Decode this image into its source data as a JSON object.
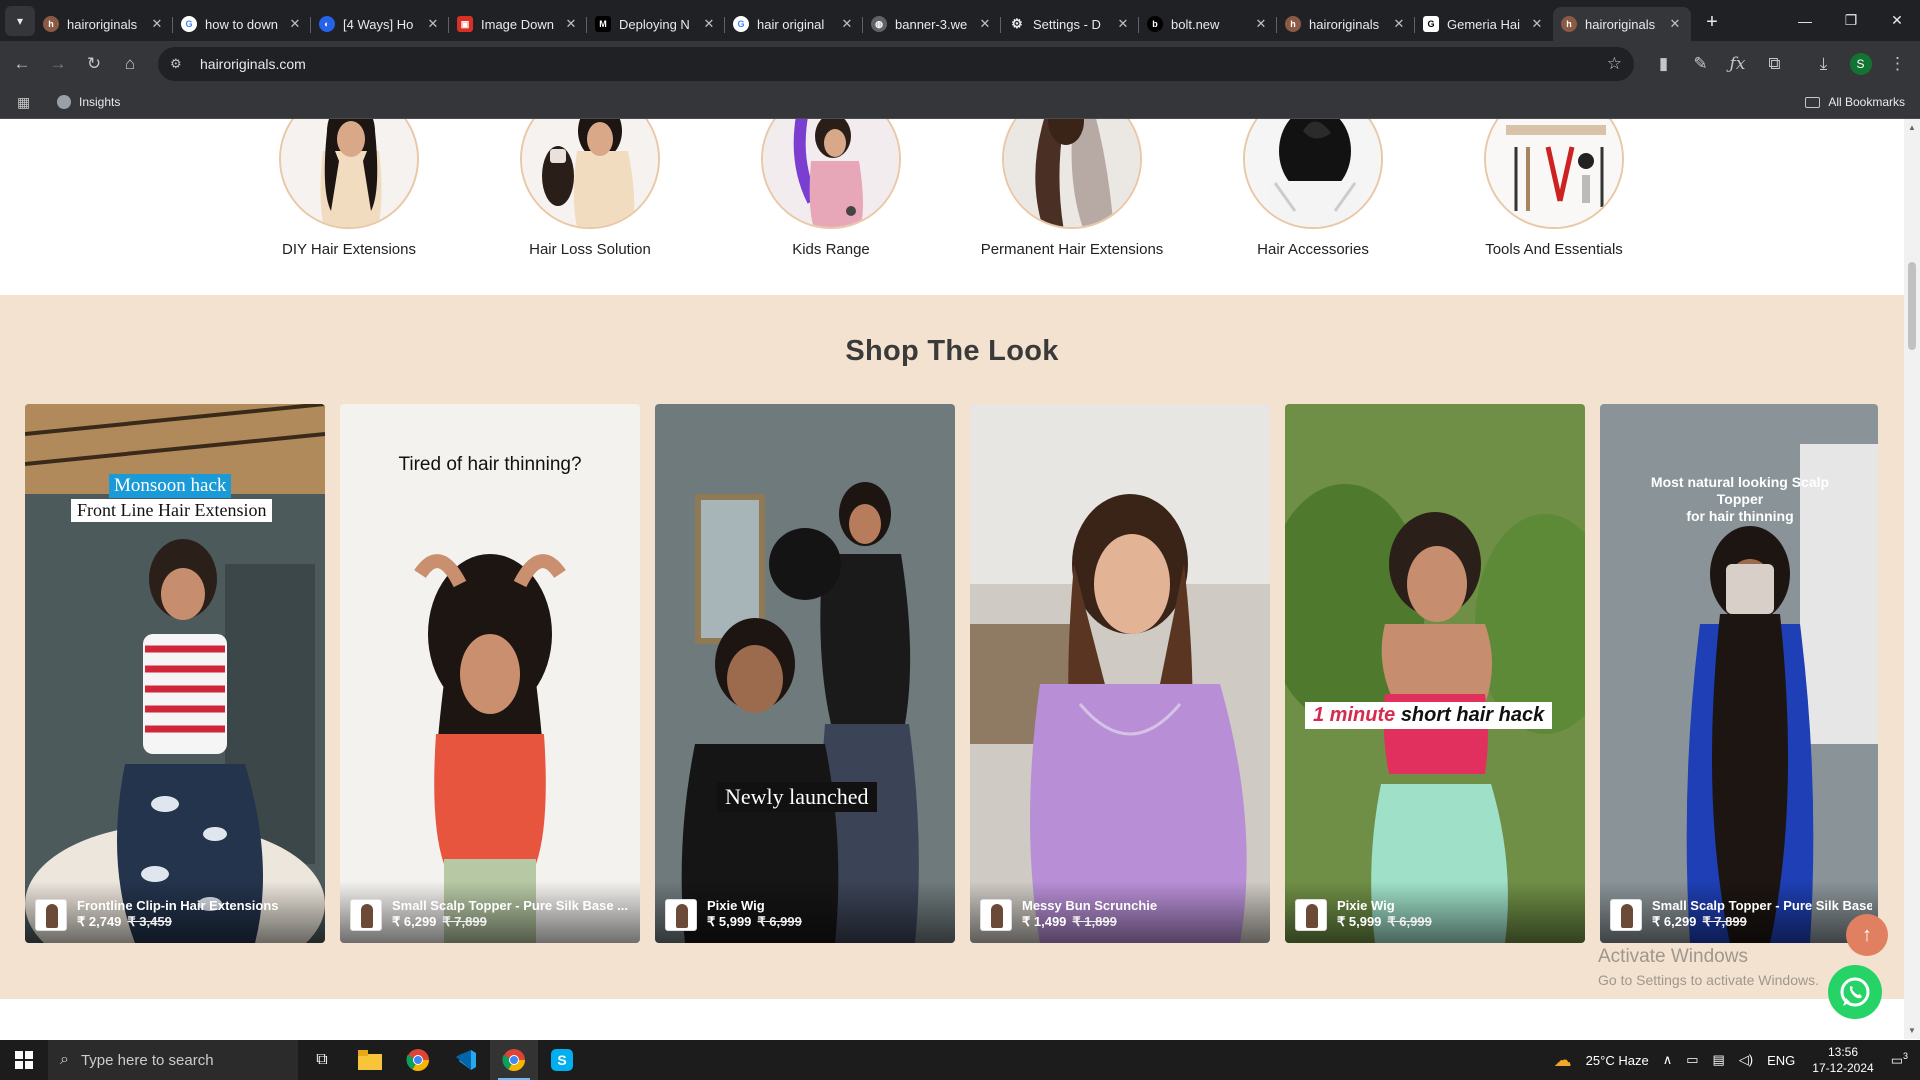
{
  "browser": {
    "tabs": [
      {
        "title": "hairoriginals",
        "active": false,
        "favicon": "hairoriginals-icon"
      },
      {
        "title": "how to down",
        "active": false,
        "favicon": "google-icon"
      },
      {
        "title": "[4 Ways] Ho",
        "active": false,
        "favicon": "edge-blue-icon"
      },
      {
        "title": "Image Down",
        "active": false,
        "favicon": "image-download-icon"
      },
      {
        "title": "Deploying N",
        "active": false,
        "favicon": "medium-icon"
      },
      {
        "title": "hair original",
        "active": false,
        "favicon": "google-icon"
      },
      {
        "title": "banner-3.we",
        "active": false,
        "favicon": "globe-icon"
      },
      {
        "title": "Settings - D",
        "active": false,
        "favicon": "gear-icon"
      },
      {
        "title": "bolt.new",
        "active": false,
        "favicon": "bolt-icon"
      },
      {
        "title": "hairoriginals",
        "active": false,
        "favicon": "hairoriginals-icon"
      },
      {
        "title": "Gemeria Hai",
        "active": false,
        "favicon": "gemeria-icon"
      },
      {
        "title": "hairoriginals",
        "active": true,
        "favicon": "hairoriginals-icon"
      }
    ],
    "url": "hairoriginals.com",
    "bookmarks": [
      {
        "label": "Insights"
      }
    ],
    "all_bookmarks_label": "All Bookmarks",
    "profile_initial": "S"
  },
  "categories": [
    {
      "label": "DIY Hair Extensions"
    },
    {
      "label": "Hair Loss Solution"
    },
    {
      "label": "Kids Range"
    },
    {
      "label": "Permanent Hair Extensions"
    },
    {
      "label": "Hair Accessories"
    },
    {
      "label": "Tools And Essentials"
    }
  ],
  "shop": {
    "title": "Shop The Look",
    "cards": [
      {
        "overlay_lines": [
          "Monsoon hack",
          "Front Line Hair Extension"
        ],
        "product": "Frontline Clip-in Hair Extensions",
        "price": "₹ 2,749",
        "mrp": "₹ 3,459"
      },
      {
        "overlay_lines": [
          "Tired of hair thinning?"
        ],
        "product": "Small Scalp Topper - Pure Silk Base ...",
        "price": "₹ 6,299",
        "mrp": "₹ 7,899"
      },
      {
        "overlay_lines": [
          "Newly launched"
        ],
        "product": "Pixie Wig",
        "price": "₹ 5,999",
        "mrp": "₹ 6,999"
      },
      {
        "overlay_lines": [],
        "product": "Messy Bun Scrunchie",
        "price": "₹ 1,499",
        "mrp": "₹ 1,899"
      },
      {
        "overlay_lines": [
          "1 minute",
          "short hair hack"
        ],
        "product": "Pixie Wig",
        "price": "₹ 5,999",
        "mrp": "₹ 6,999"
      },
      {
        "overlay_lines": [
          "Most natural looking Scalp Topper",
          "for hair thinning"
        ],
        "product": "Small Scalp Topper - Pure Silk Base ...",
        "price": "₹ 6,299",
        "mrp": "₹ 7,899"
      }
    ]
  },
  "watermark": {
    "line1": "Activate Windows",
    "line2": "Go to Settings to activate Windows."
  },
  "taskbar": {
    "search_placeholder": "Type here to search",
    "weather": "25°C  Haze",
    "language": "ENG",
    "time": "13:56",
    "date": "17-12-2024",
    "notification_count": "3"
  },
  "colors": {
    "shop_bg": "#f3e2cf",
    "accent_orange": "#e08060",
    "whatsapp_green": "#25d366",
    "monsoon_blue": "#1a9bd7",
    "hack_red": "#d62b50"
  }
}
